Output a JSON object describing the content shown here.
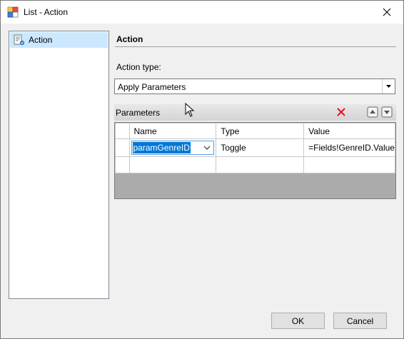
{
  "window": {
    "title": "List - Action"
  },
  "sidebar": {
    "items": [
      {
        "label": "Action",
        "selected": true
      }
    ]
  },
  "main": {
    "section_title": "Action",
    "action_type_label": "Action type:",
    "action_type_value": "Apply Parameters"
  },
  "parameters": {
    "label": "Parameters",
    "columns": [
      "Name",
      "Type",
      "Value"
    ],
    "rows": [
      {
        "name": "paramGenreID",
        "type": "Toggle",
        "value": "=Fields!GenreID.Value"
      },
      {
        "name": "",
        "type": "",
        "value": ""
      }
    ]
  },
  "buttons": {
    "ok": "OK",
    "cancel": "Cancel"
  },
  "icons": {
    "app": "report-list-icon",
    "close": "close-icon",
    "delete": "delete-x-icon",
    "move_up": "move-up-icon",
    "move_down": "move-down-icon"
  },
  "colors": {
    "selection": "#cce8ff",
    "highlight": "#0078d7",
    "delete": "#e81123"
  }
}
